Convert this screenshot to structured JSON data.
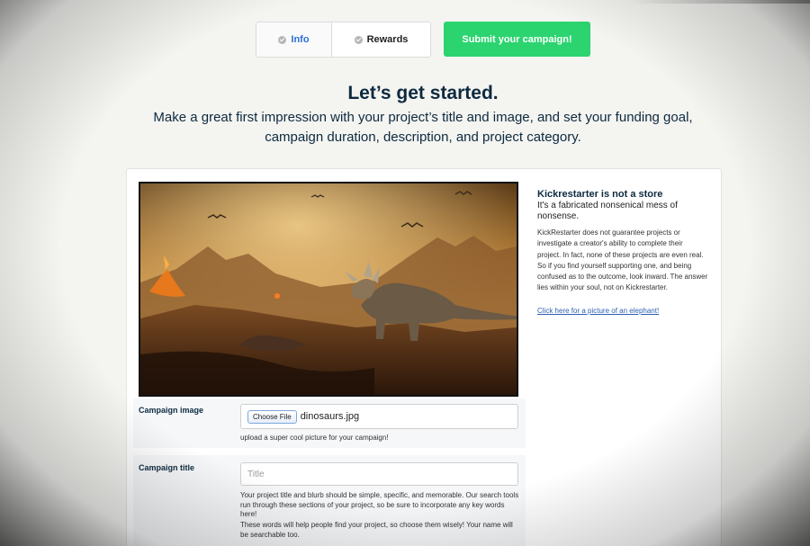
{
  "tabs": [
    {
      "label": "Info",
      "icon": "check-icon",
      "color": "#2c6fd6"
    },
    {
      "label": "Rewards",
      "icon": "check-icon"
    }
  ],
  "submit_label": "Submit your campaign!",
  "accent_color": "#2bd46f",
  "hero": {
    "title": "Let’s get started.",
    "subtitle": "Make a great first impression with your project’s title and image, and set your funding goal, campaign duration, description, and project category."
  },
  "image": {
    "subject": "dinosaurs.jpg"
  },
  "sidebar": {
    "heading": "Kickrestarter is not a store",
    "tagline": "It's a fabricated nonsenical mess of nonsense.",
    "body": "KickRestarter does not guarantee projects or investigate a creator's ability to complete their project. In fact, none of these projects are even real. So if you find yourself supporting one, and being confused as to the outcome, look inward. The answer lies within your soul, not on Kickrestarter.",
    "link": "Click here for a picture of an elephant!"
  },
  "form": {
    "image_label": "Campaign image",
    "choose_file": "Choose File",
    "file_name": "dinosaurs.jpg",
    "image_hint": "upload a super cool picture for your campaign!",
    "title_label": "Campaign title",
    "title_placeholder": "Title",
    "title_value": "",
    "title_hint1": "Your project title and blurb should be simple, specific, and memorable. Our search tools run through these sections of your project, so be sure to incorporate any key words here!",
    "title_hint2": "These words will help people find your project, so choose them wisely! Your name will be searchable too."
  }
}
